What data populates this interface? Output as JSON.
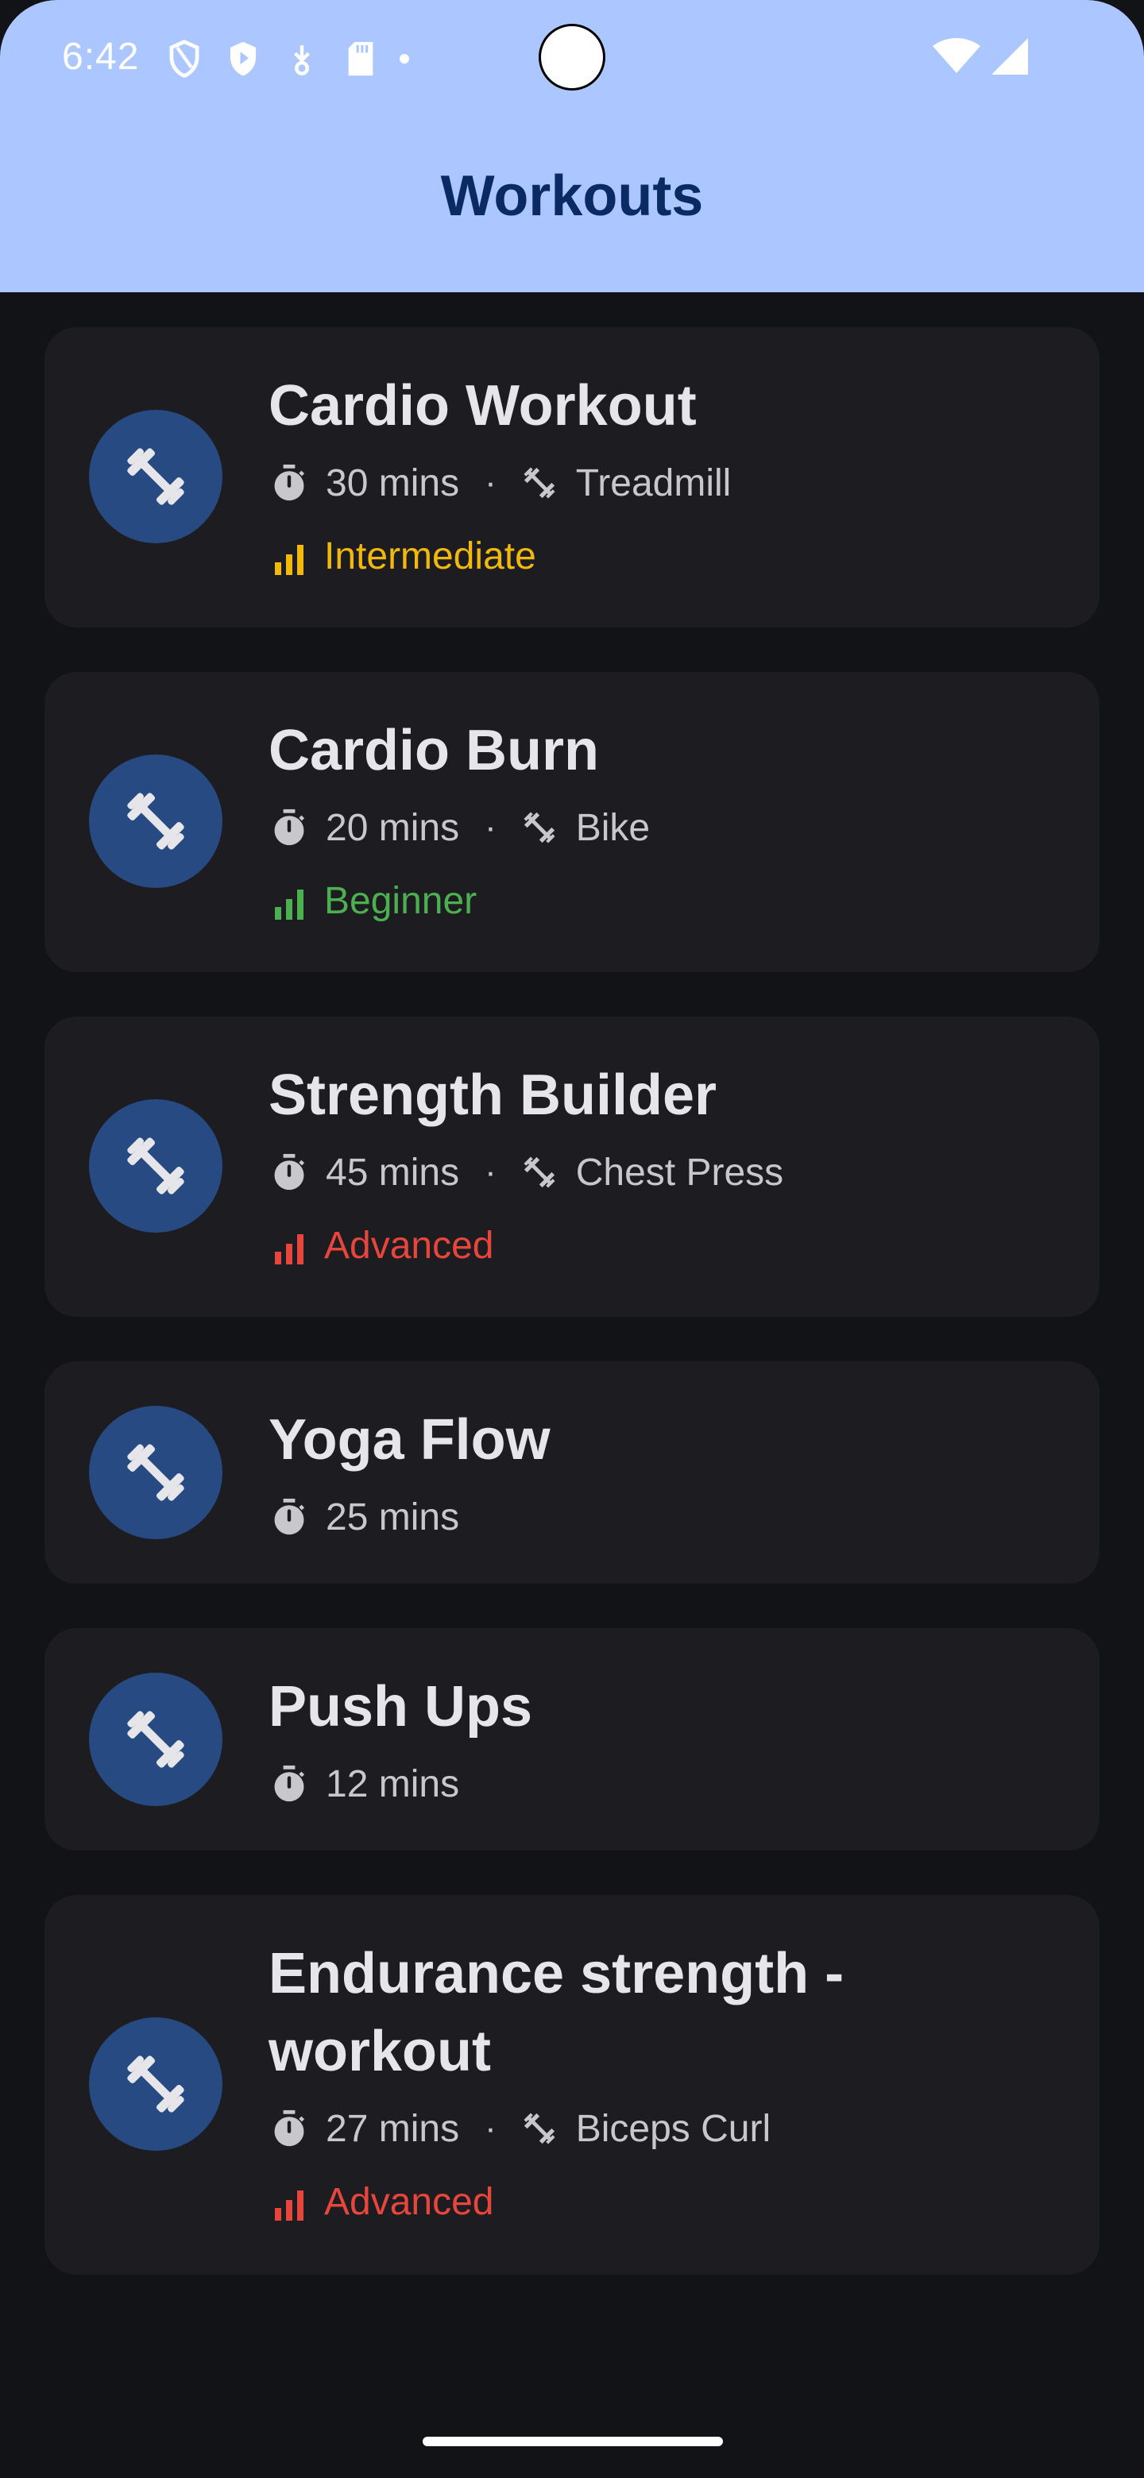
{
  "status_bar": {
    "time": "6:42",
    "icons_left": [
      "shield-icon",
      "play-protect-icon",
      "download-icon",
      "sd-card-icon",
      "dot-icon"
    ],
    "icons_right": [
      "wifi-icon",
      "cellular-signal-icon"
    ]
  },
  "app_bar": {
    "title": "Workouts",
    "background_color": "#acc7ff",
    "title_color": "#0a2a66"
  },
  "level_colors": {
    "Intermediate": "#f2b90c",
    "Beginner": "#4caf50",
    "Advanced": "#e8453c"
  },
  "workouts": [
    {
      "title": "Cardio Workout",
      "duration": "30 mins",
      "equipment": "Treadmill",
      "level": "Intermediate"
    },
    {
      "title": "Cardio Burn",
      "duration": "20 mins",
      "equipment": "Bike",
      "level": "Beginner"
    },
    {
      "title": "Strength Builder",
      "duration": "45 mins",
      "equipment": "Chest Press",
      "level": "Advanced"
    },
    {
      "title": "Yoga Flow",
      "duration": "25 mins"
    },
    {
      "title": "Push Ups",
      "duration": "12 mins"
    },
    {
      "title": "Endurance strength - workout",
      "duration": "27 mins",
      "equipment": "Biceps Curl",
      "level": "Advanced"
    }
  ],
  "meta_separator": "·",
  "icons": {
    "avatar": "dumbbell-icon",
    "duration": "stopwatch-icon",
    "equipment": "dumbbell-icon",
    "level": "signal-bars-icon"
  }
}
